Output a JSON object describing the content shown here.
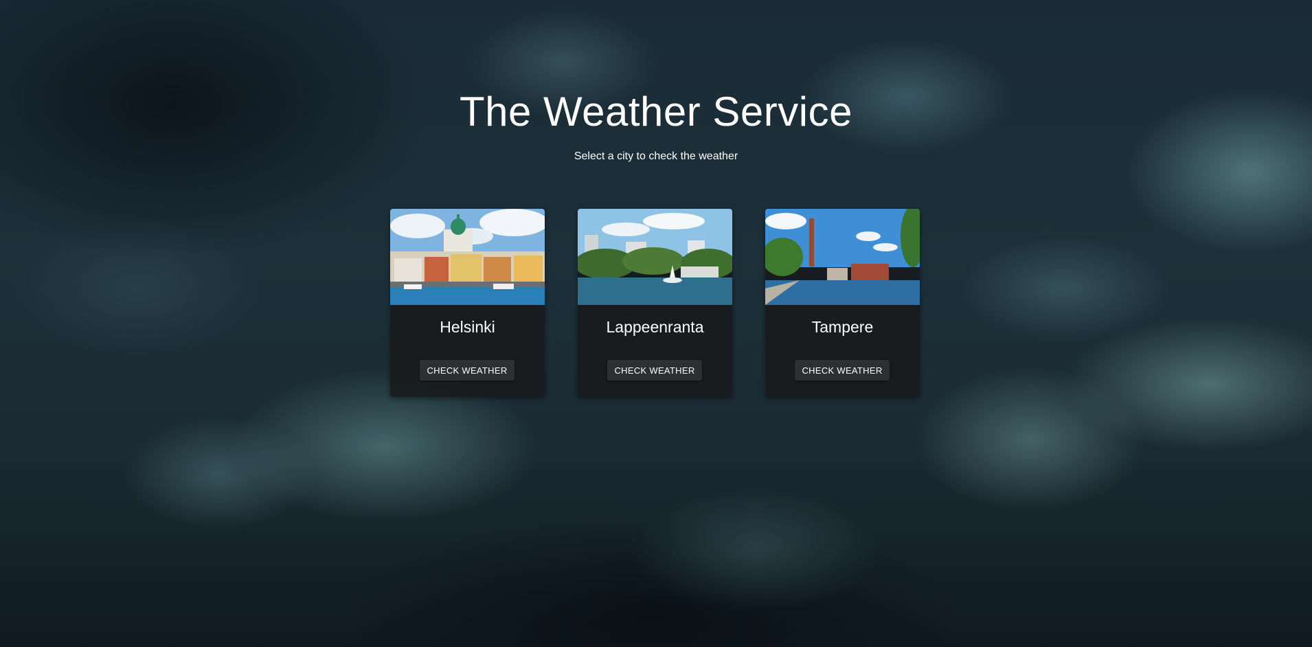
{
  "page": {
    "title": "The Weather Service",
    "subtitle": "Select a city to check the weather"
  },
  "cities": [
    {
      "name": "Helsinki",
      "button_label": "CHECK WEATHER"
    },
    {
      "name": "Lappeenranta",
      "button_label": "CHECK WEATHER"
    },
    {
      "name": "Tampere",
      "button_label": "CHECK WEATHER"
    }
  ],
  "colors": {
    "card_background": "#181a1c",
    "button_background": "#2d3033",
    "text": "#ffffff"
  }
}
